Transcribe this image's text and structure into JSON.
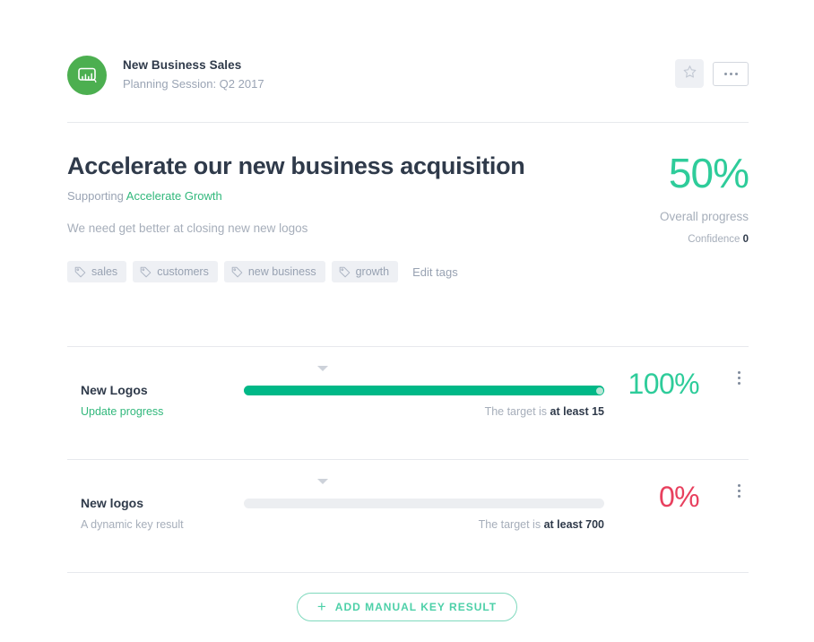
{
  "header": {
    "avatar_icon": "presentation-board-icon",
    "title": "New Business Sales",
    "subtitle": "Planning Session: Q2 2017",
    "star_icon": "star-outline-icon",
    "more_icon": "ellipsis-horizontal-icon"
  },
  "objective": {
    "title": "Accelerate our new business acquisition",
    "supporting_prefix": "Supporting",
    "supporting_link": "Accelerate Growth",
    "description": "We need get better at closing new new logos"
  },
  "tags": {
    "items": [
      {
        "label": "sales",
        "icon": "tag-icon"
      },
      {
        "label": "customers",
        "icon": "tag-icon"
      },
      {
        "label": "new business",
        "icon": "tag-icon"
      },
      {
        "label": "growth",
        "icon": "tag-icon"
      }
    ],
    "edit_label": "Edit tags"
  },
  "overall": {
    "percent": "50%",
    "label": "Overall progress",
    "confidence_label": "Confidence",
    "confidence_value": "0"
  },
  "key_results": [
    {
      "name": "New Logos",
      "sub_label": "Update progress",
      "sub_style": "link",
      "marker_position_pct": 22,
      "progress_pct": 100,
      "target_prefix": "The target is",
      "target_value": "at least 15",
      "percent": "100%",
      "percent_color": "green",
      "menu_icon": "ellipsis-vertical-icon"
    },
    {
      "name": "New logos",
      "sub_label": "A dynamic key result",
      "sub_style": "muted",
      "marker_position_pct": 22,
      "progress_pct": 0,
      "target_prefix": "The target is",
      "target_value": "at least 700",
      "percent": "0%",
      "percent_color": "red",
      "menu_icon": "ellipsis-vertical-icon"
    }
  ],
  "footer": {
    "add_label": "ADD MANUAL KEY RESULT",
    "add_icon": "plus-icon"
  },
  "colors": {
    "accent_green": "#2ecc9a",
    "progress_green": "#00b887",
    "avatar_green": "#4caf50",
    "link_green": "#32b87c",
    "danger_red": "#e8405e",
    "text_dark": "#2f3a4a",
    "text_muted": "#a6aeba",
    "divider": "#e7e9ed",
    "chip_bg": "#eef0f4"
  }
}
